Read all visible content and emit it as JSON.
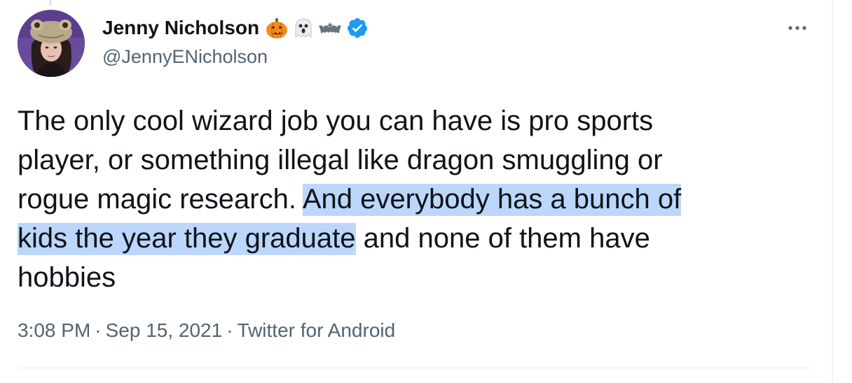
{
  "author": {
    "display_name": "Jenny Nicholson",
    "handle": "@JennyENicholson",
    "name_emojis": [
      "pumpkin-emoji",
      "ghost-emoji",
      "bat-emoji"
    ],
    "verified": true
  },
  "tweet": {
    "text_segments": [
      "The only cool wizard job you can have is pro sports",
      "player, or something illegal like dragon smuggling or",
      "rogue magic research. ",
      "And everybody has a bunch of",
      "kids the year they graduate",
      " and none of them have",
      "hobbies"
    ],
    "highlight_color": "#bcd7fb"
  },
  "meta": {
    "time": "3:08 PM",
    "date": "Sep 15, 2021",
    "source": "Twitter for Android",
    "separator": "·"
  },
  "colors": {
    "text": "#0f1419",
    "secondary": "#536471",
    "verified_blue": "#1d9bf0"
  }
}
